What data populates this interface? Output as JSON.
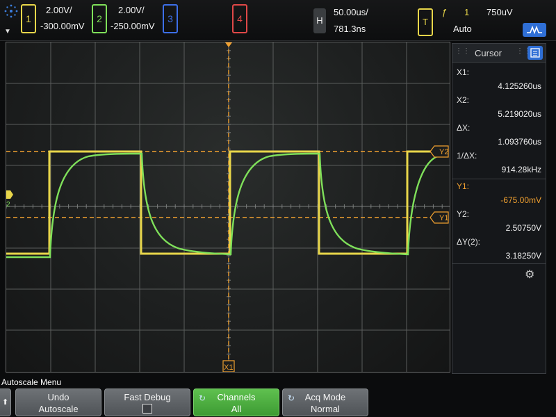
{
  "header": {
    "ch1": {
      "number": "1",
      "scale": "2.00V/",
      "offset": "-300.00mV",
      "color": "#e8d64a"
    },
    "ch2": {
      "number": "2",
      "scale": "2.00V/",
      "offset": "-250.00mV",
      "color": "#7fe05a"
    },
    "ch3": {
      "number": "3",
      "color": "#3d6fe8"
    },
    "ch4": {
      "number": "4",
      "color": "#e04848"
    },
    "horizontal": {
      "label": "H",
      "timebase": "50.00us/",
      "delay": "781.3ns"
    },
    "trigger": {
      "label": "T",
      "slope_icon": "ƒ",
      "source": "1",
      "level": "750uV",
      "mode": "Auto"
    }
  },
  "cursor_panel": {
    "title": "Cursor",
    "rows": [
      {
        "label": "X1:",
        "value": "4.125260us"
      },
      {
        "label": "X2:",
        "value": "5.219020us"
      },
      {
        "label": "ΔX:",
        "value": "1.093760us"
      },
      {
        "label": "1/ΔX:",
        "value": "914.28kHz"
      },
      {
        "label": "Y1:",
        "value": "-675.00mV"
      },
      {
        "label": "Y2:",
        "value": "2.50750V"
      },
      {
        "label": "ΔY(2):",
        "value": "3.18250V"
      }
    ]
  },
  "markers": {
    "y2": "Y2",
    "y1": "Y1",
    "x1": "X1",
    "ch1_ground": "1",
    "ch2_ground": "2"
  },
  "softkeys": {
    "menu_title": "Autoscale Menu",
    "undo": {
      "line1": "Undo",
      "line2": "Autoscale"
    },
    "fast_debug": {
      "line1": "Fast Debug"
    },
    "channels": {
      "line1": "Channels",
      "line2": "All"
    },
    "acq_mode": {
      "line1": "Acq Mode",
      "line2": "Normal"
    }
  },
  "colors": {
    "cursor_orange": "#f0a030",
    "panel_accent": "#2f6fd6"
  }
}
